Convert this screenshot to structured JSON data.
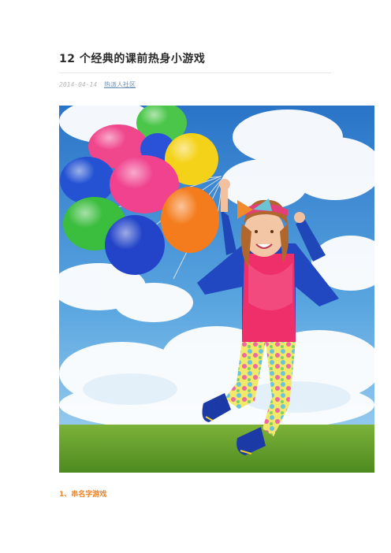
{
  "article": {
    "title": "12 个经典的课前热身小游戏",
    "date": "2014-04-14",
    "source_link": "热派人社区",
    "section_heading": "1、串名字游戏"
  }
}
